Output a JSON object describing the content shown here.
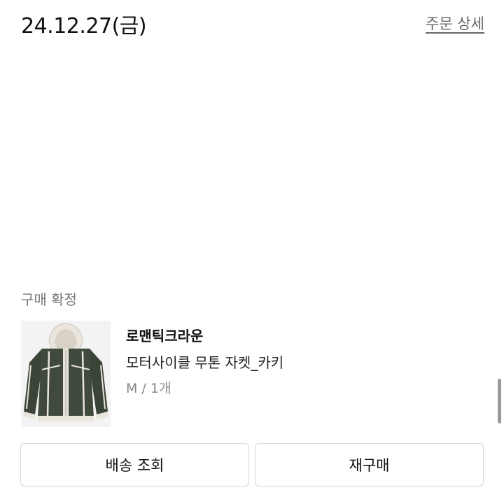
{
  "order": {
    "date": "24.12.27(금)",
    "detail_link": "주문 상세"
  },
  "item": {
    "status": "구매 확정",
    "brand": "로맨틱크라운",
    "name": "모터사이클 무톤 자켓_카키",
    "option": "M / 1개",
    "image_icon": "khaki-jacket-thumbnail"
  },
  "actions": {
    "track_label": "배송 조회",
    "reorder_label": "재구매"
  },
  "colors": {
    "jacket_khaki": "#3f4a3c",
    "shearling": "#e9e5dc"
  }
}
